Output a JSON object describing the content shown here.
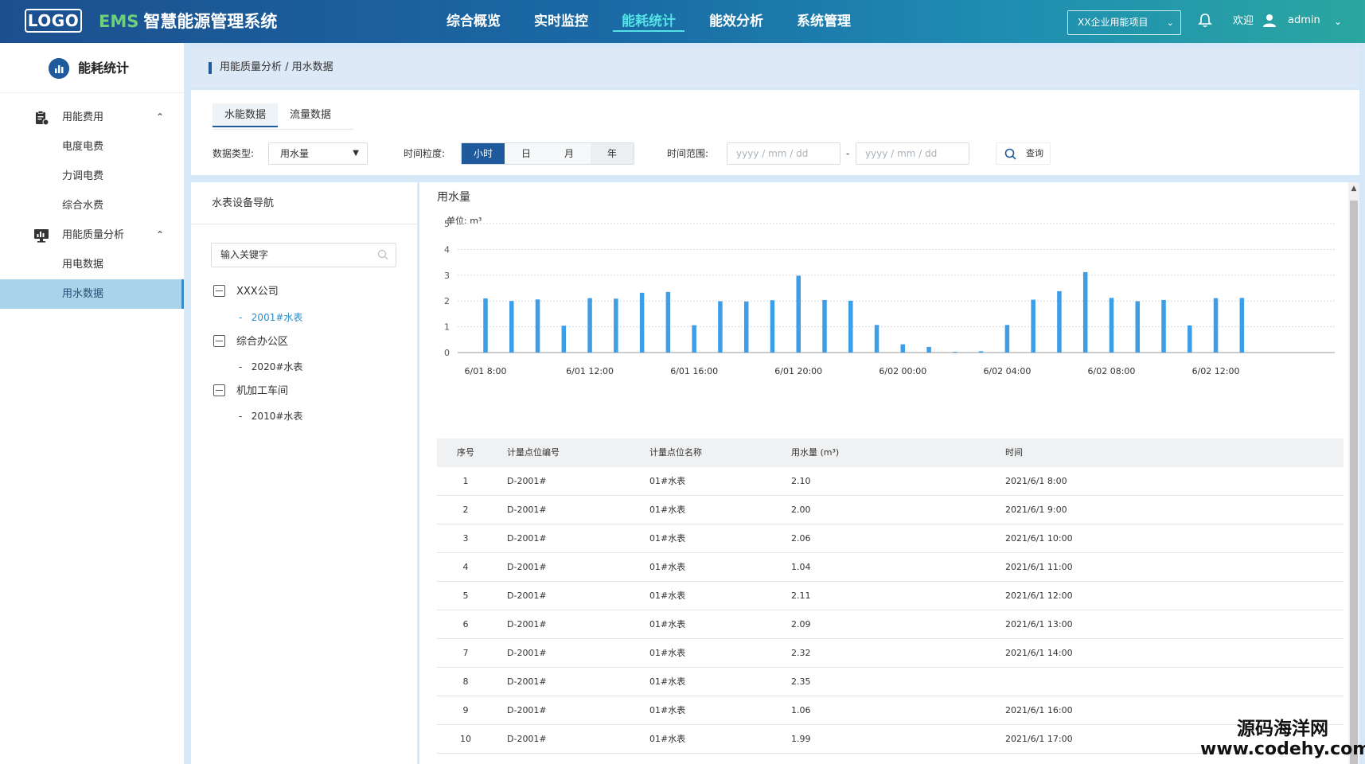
{
  "header": {
    "logo": "LOGO",
    "brand": "EMS",
    "title": "智慧能源管理系统",
    "nav": [
      "综合概览",
      "实时监控",
      "能耗统计",
      "能效分析",
      "系统管理"
    ],
    "active_nav_index": 2,
    "project_select": "XX企业用能项目",
    "welcome": "欢迎",
    "username": "admin"
  },
  "sidebar": {
    "title": "能耗统计",
    "groups": [
      {
        "label": "用能费用",
        "items": [
          "电度电费",
          "力调电费",
          "综合水费"
        ]
      },
      {
        "label": "用能质量分析",
        "items": [
          "用电数据",
          "用水数据"
        ]
      }
    ],
    "active_item": "用水数据"
  },
  "breadcrumb": "用能质量分析 / 用水数据",
  "filters": {
    "tabs": [
      "水能数据",
      "流量数据"
    ],
    "active_tab": "水能数据",
    "data_type_label": "数据类型:",
    "data_type_value": "用水量",
    "granularity_label": "时间粒度:",
    "granularity_options": [
      "小时",
      "日",
      "月",
      "年"
    ],
    "granularity_active": "小时",
    "range_label": "时间范围:",
    "date_placeholder": "yyyy / mm / dd",
    "date_separator": "-",
    "query_label": "查询"
  },
  "tree": {
    "title": "水表设备导航",
    "search_placeholder": "输入关键字",
    "nodes": [
      {
        "label": "XXX公司",
        "children": [
          "2001#水表"
        ]
      },
      {
        "label": "综合办公区",
        "children": [
          "2020#水表"
        ]
      },
      {
        "label": "机加工车间",
        "children": [
          "2010#水表"
        ]
      }
    ],
    "leaf_prefix": "-",
    "active_leaf": "2001#水表"
  },
  "chart_data": {
    "type": "bar",
    "title": "用水量",
    "unit_label": "单位:  m³",
    "ylim": [
      0,
      5
    ],
    "yticks": [
      0,
      1,
      2,
      3,
      4,
      5
    ],
    "grid": true,
    "x_tick_labels": [
      "6/01 8:00",
      "6/01 12:00",
      "6/01 16:00",
      "6/01 20:00",
      "6/02 00:00",
      "6/02 04:00",
      "6/02 08:00",
      "6/02 12:00"
    ],
    "color": "#3d9de6",
    "values": [
      2.1,
      2.0,
      2.06,
      1.04,
      2.11,
      2.09,
      2.32,
      2.35,
      1.06,
      1.99,
      1.98,
      2.03,
      2.98,
      2.04,
      2.01,
      1.07,
      0.32,
      0.22,
      0.03,
      0.05,
      1.07,
      2.05,
      2.38,
      3.12,
      2.12,
      1.99,
      2.04,
      1.05,
      2.11,
      2.12
    ]
  },
  "table": {
    "headers": [
      "序号",
      "计量点位编号",
      "计量点位名称",
      "用水量 (m³)",
      "时间"
    ],
    "rows": [
      [
        "1",
        "D-2001#",
        "01#水表",
        "2.10",
        "2021/6/1 8:00"
      ],
      [
        "2",
        "D-2001#",
        "01#水表",
        "2.00",
        "2021/6/1 9:00"
      ],
      [
        "3",
        "D-2001#",
        "01#水表",
        "2.06",
        "2021/6/1 10:00"
      ],
      [
        "4",
        "D-2001#",
        "01#水表",
        "1.04",
        "2021/6/1 11:00"
      ],
      [
        "5",
        "D-2001#",
        "01#水表",
        "2.11",
        "2021/6/1 12:00"
      ],
      [
        "6",
        "D-2001#",
        "01#水表",
        "2.09",
        "2021/6/1 13:00"
      ],
      [
        "7",
        "D-2001#",
        "01#水表",
        "2.32",
        "2021/6/1 14:00"
      ],
      [
        "8",
        "D-2001#",
        "01#水表",
        "2.35",
        ""
      ],
      [
        "9",
        "D-2001#",
        "01#水表",
        "1.06",
        "2021/6/1 16:00"
      ],
      [
        "10",
        "D-2001#",
        "01#水表",
        "1.99",
        "2021/6/1 17:00"
      ]
    ]
  },
  "watermark": {
    "line1": "源码海洋网",
    "line2": "www.codehy.com"
  },
  "colors": {
    "primary": "#1e5a9c",
    "accent": "#55e2e6",
    "bar": "#3d9de6",
    "active_bg": "#a9d3ea"
  }
}
